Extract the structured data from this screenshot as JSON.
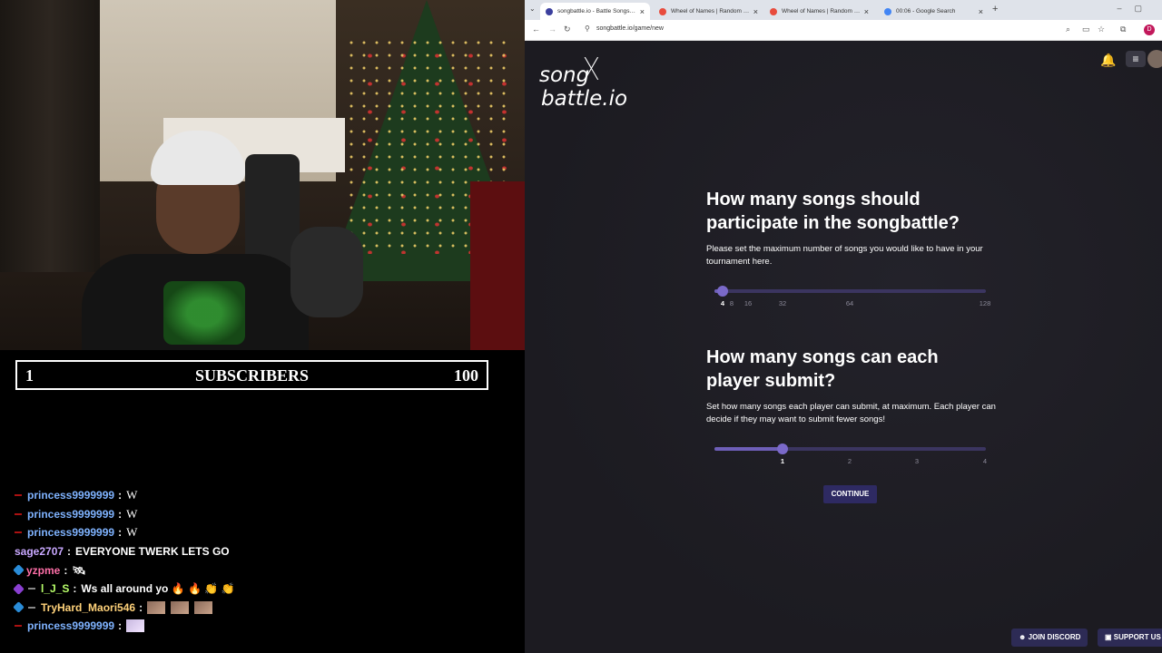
{
  "subscribers": {
    "current": "1",
    "label": "SUBSCRIBERS",
    "goal": "100"
  },
  "chat": [
    {
      "user": "princess9999999",
      "color": "#7fb3ff",
      "badges": [
        "dash"
      ],
      "message": "W",
      "serif": true
    },
    {
      "user": "princess9999999",
      "color": "#7fb3ff",
      "badges": [
        "dash"
      ],
      "message": "W",
      "serif": true
    },
    {
      "user": "princess9999999",
      "color": "#7fb3ff",
      "badges": [
        "dash"
      ],
      "message": "W",
      "serif": true
    },
    {
      "user": "sage2707",
      "color": "#c9a8ff",
      "badges": [],
      "message": "EVERYONE TWERK LETS GO"
    },
    {
      "user": "yzpme",
      "color": "#ff6fa8",
      "badges": [
        "cube"
      ],
      "message": "🛰"
    },
    {
      "user": "l_J_S",
      "color": "#b8ff6a",
      "badges": [
        "cube-purple",
        "dash2"
      ],
      "message": "Ws all around yo 🔥 🔥 👏 👏"
    },
    {
      "user": "TryHard_Maori546",
      "color": "#ffd27a",
      "badges": [
        "cube",
        "dash2"
      ],
      "message": "",
      "emotes": 3
    },
    {
      "user": "princess9999999",
      "color": "#7fb3ff",
      "badges": [
        "dash"
      ],
      "message": "",
      "emotes": 1,
      "emote_style": "pink"
    }
  ],
  "browser": {
    "tabs": [
      {
        "title": "songbattle.io - Battle Songs ag",
        "active": true,
        "favicon_color": "#3b3f9e"
      },
      {
        "title": "Wheel of Names | Random nan",
        "active": false,
        "favicon_color": "#e84c3d"
      },
      {
        "title": "Wheel of Names | Random nan",
        "active": false,
        "favicon_color": "#e84c3d"
      },
      {
        "title": "00:06 - Google Search",
        "active": false,
        "favicon_color": "#4285f4"
      }
    ],
    "url": "songbattle.io/game/new",
    "profile_initial": "D"
  },
  "site": {
    "logo_line1": "song",
    "logo_line2": "battle.io",
    "q1": {
      "title": "How many songs should participate in the songbattle?",
      "desc": "Please set the maximum number of songs you would like to have in your tournament here.",
      "ticks": [
        "4",
        "8",
        "16",
        "32",
        "64",
        "128"
      ],
      "selected": "4"
    },
    "q2": {
      "title": "How many songs can each player submit?",
      "desc": "Set how many songs each player can submit, at maximum. Each player can decide if they may want to submit fewer songs!",
      "ticks": [
        "1",
        "2",
        "3",
        "4"
      ],
      "selected": "1"
    },
    "continue_label": "CONTINUE",
    "discord_label": "JOIN DISCORD",
    "support_label": "SUPPORT US"
  }
}
